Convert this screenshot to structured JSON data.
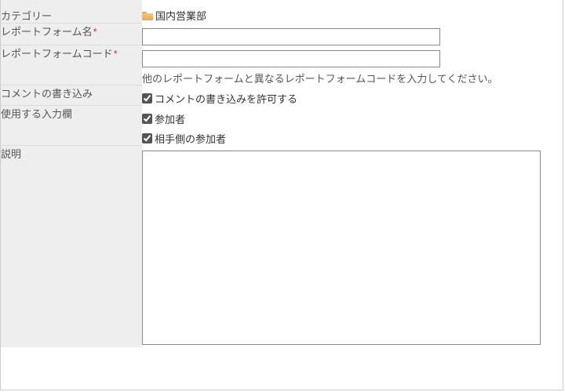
{
  "labels": {
    "category": "カテゴリー",
    "formName": "レポートフォーム名",
    "formCode": "レポートフォームコード",
    "comment": "コメントの書き込み",
    "inputs": "使用する入力欄",
    "description": "説明"
  },
  "requiredMark": "*",
  "category": {
    "value": "国内営業部"
  },
  "formName": {
    "value": ""
  },
  "formCode": {
    "value": "",
    "helper": "他のレポートフォームと異なるレポートフォームコードを入力してください。"
  },
  "comment": {
    "allowLabel": "コメントの書き込みを許可する",
    "allowChecked": true
  },
  "inputFields": {
    "participantsLabel": "参加者",
    "participantsChecked": true,
    "otherParticipantsLabel": "相手側の参加者",
    "otherParticipantsChecked": true
  },
  "description": {
    "value": ""
  }
}
